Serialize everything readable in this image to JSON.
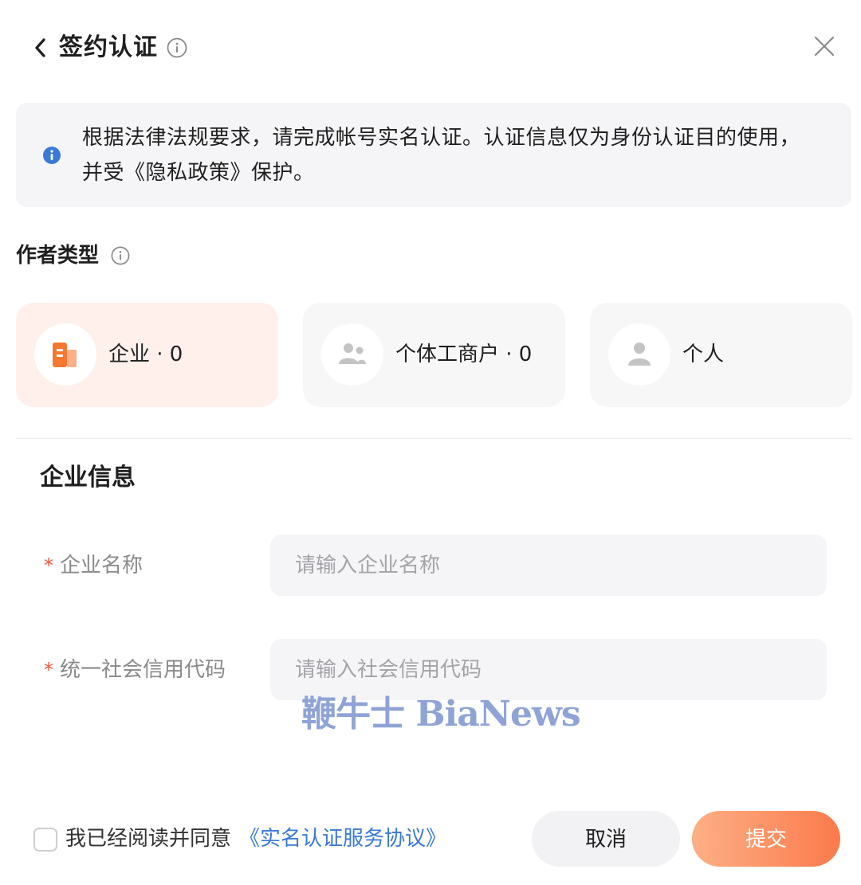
{
  "header": {
    "title": "签约认证",
    "back_icon": "chevron-left-icon",
    "info_icon": "info-circle-icon",
    "close_icon": "close-icon"
  },
  "notice": {
    "icon": "info-filled-icon",
    "icon_color": "#3a79d6",
    "text": "根据法律法规要求，请完成帐号实名认证。认证信息仅为身份认证目的使用，并受《隐私政策》保护。"
  },
  "author_type": {
    "label": "作者类型",
    "info_icon": "info-circle-icon",
    "options": [
      {
        "label": "企业 · 0",
        "icon": "building-icon",
        "selected": true
      },
      {
        "label": "个体工商户 · 0",
        "icon": "users-icon",
        "selected": false
      },
      {
        "label": "个人",
        "icon": "user-icon",
        "selected": false
      }
    ]
  },
  "form": {
    "title": "企业信息",
    "fields": [
      {
        "required_mark": "*",
        "label": "企业名称",
        "placeholder": "请输入企业名称",
        "value": ""
      },
      {
        "required_mark": "*",
        "label": "统一社会信用代码",
        "placeholder": "请输入社会信用代码",
        "value": ""
      }
    ]
  },
  "watermark": "鞭牛士 BiaNews",
  "footer": {
    "agree_text": "我已经阅读并同意",
    "agree_link": "《实名认证服务协议》",
    "agree_checked": false,
    "cancel_label": "取消",
    "submit_label": "提交"
  },
  "colors": {
    "accent": "#fb7a4b",
    "selected_card_bg": "#fff0ec",
    "link": "#3a79d6",
    "required": "#f0543c"
  }
}
